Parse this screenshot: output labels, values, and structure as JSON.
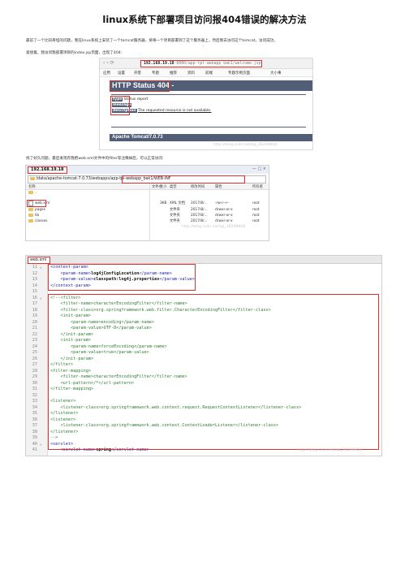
{
  "title": "linux系统下部署项目访问报404错误的解决方法",
  "intro_line1": "最前了一个比较奇怪的问题，我在linux系统上安装了一个tomcat服务器，将将一个项目部署到了这个服务器上，然后我去访问这个tomcat，访问成功，",
  "intro_dot": "·",
  "intro_line2": "紧接着，我访问我部署项目的index.jsp页面，出现了404:",
  "shot1": {
    "nav": "‹ › ⟳",
    "url_host": "192.168.19.18",
    "url_rest": ":8080/app-tpl-webapp_bak1/welcome.jsp",
    "bookmarks": [
      "应用",
      "设置",
      "开客",
      "专题",
      "推荐",
      "资料",
      "前端",
      "专题示例页面",
      "大小事"
    ],
    "error_title": "HTTP Status 404 -",
    "type_label": "type",
    "type_value": "Status report",
    "message_label": "message",
    "message_value": "",
    "description_label": "description",
    "description_value": "The requested resource is not available.",
    "footer": "Apache Tomcat/7.0.73",
    "watermark": "http://blog.csdn.net/qq_36298908"
  },
  "mid_text": "找了好久问题，最后发现有我把web.xml文件中的filter等注释掉后，可以正常访问:",
  "shot2": {
    "host": "192.168.19.18",
    "win_controls": "— □ ×",
    "path": "/data/apache-tomcat-7.0.73/webapps/app-tpl-webapp_bak1/WEB-INF",
    "left_header": "名称",
    "left_items": [
      {
        "name": "..",
        "type": "up"
      },
      {
        "name": "web.xml",
        "type": "file"
      },
      {
        "name": "pages",
        "type": "folder"
      },
      {
        "name": "lib",
        "type": "folder"
      },
      {
        "name": "classes",
        "type": "folder"
      }
    ],
    "right_headers": [
      "文件名",
      "大小",
      "类型",
      "修改时间",
      "属性",
      "所有者"
    ],
    "right_rows": [
      [
        "..",
        "",
        "",
        "",
        "",
        ""
      ],
      [
        "web.xml",
        "3KB",
        "XML 文档",
        "2017/8/...",
        "-rw-r--r--",
        "root"
      ],
      [
        "pages",
        "",
        "文件夹",
        "2017/8/...",
        "drwxr-xr-x",
        "root"
      ],
      [
        "lib",
        "",
        "文件夹",
        "2017/8/...",
        "drwxr-xr-x",
        "root"
      ],
      [
        "classes",
        "",
        "文件夹",
        "2017/8/...",
        "drwxr-xr-x",
        "root"
      ]
    ],
    "watermark": "http://blog.csdn.net/qq_36298908"
  },
  "shot3": {
    "tab": "web.xml ×",
    "lines": [
      {
        "n": "11",
        "f": "⊖",
        "h": "<span class=\"tag\">&lt;context-param&gt;</span>"
      },
      {
        "n": "12",
        "f": "",
        "h": "    <span class=\"tag\">&lt;param-name&gt;</span><span class=\"val\">log4jConfigLocation</span><span class=\"tag\">&lt;/param-name&gt;</span>"
      },
      {
        "n": "13",
        "f": "",
        "h": "    <span class=\"tag\">&lt;param-value&gt;</span><span class=\"val\">classpath:log4j.properties</span><span class=\"tag\">&lt;/param-value&gt;</span>"
      },
      {
        "n": "14",
        "f": "",
        "h": "<span class=\"tag\">&lt;/context-param&gt;</span>"
      },
      {
        "n": "15",
        "f": "",
        "h": ""
      },
      {
        "n": "16",
        "f": "⊖",
        "h": "<span class=\"cmt\">&lt;!--&lt;filter&gt;</span>"
      },
      {
        "n": "17",
        "f": "",
        "h": "<span class=\"cmt\">    &lt;filter-name&gt;characterEncodingFilter&lt;/filter-name&gt;</span>"
      },
      {
        "n": "18",
        "f": "",
        "h": "<span class=\"cmt\">    &lt;filter-class&gt;org.springframework.web.filter.CharacterEncodingFilter&lt;/filter-class&gt;</span>"
      },
      {
        "n": "19",
        "f": "",
        "h": "<span class=\"cmt\">    &lt;init-param&gt;</span>"
      },
      {
        "n": "20",
        "f": "",
        "h": "<span class=\"cmt\">        &lt;param-name&gt;encoding&lt;/param-name&gt;</span>"
      },
      {
        "n": "21",
        "f": "",
        "h": "<span class=\"cmt\">        &lt;param-value&gt;UTF-8&lt;/param-value&gt;</span>"
      },
      {
        "n": "22",
        "f": "",
        "h": "<span class=\"cmt\">    &lt;/init-param&gt;</span>"
      },
      {
        "n": "23",
        "f": "",
        "h": "<span class=\"cmt\">    &lt;init-param&gt;</span>"
      },
      {
        "n": "24",
        "f": "",
        "h": "<span class=\"cmt\">        &lt;param-name&gt;forceEncoding&lt;/param-name&gt;</span>"
      },
      {
        "n": "25",
        "f": "",
        "h": "<span class=\"cmt\">        &lt;param-value&gt;true&lt;/param-value&gt;</span>"
      },
      {
        "n": "26",
        "f": "",
        "h": "<span class=\"cmt\">    &lt;/init-param&gt;</span>"
      },
      {
        "n": "27",
        "f": "",
        "h": "<span class=\"cmt\">&lt;/filter&gt;</span>"
      },
      {
        "n": "28",
        "f": "",
        "h": "<span class=\"cmt\">&lt;filter-mapping&gt;</span>"
      },
      {
        "n": "29",
        "f": "",
        "h": "<span class=\"cmt\">    &lt;filter-name&gt;characterEncodingFilter&lt;/filter-name&gt;</span>"
      },
      {
        "n": "30",
        "f": "",
        "h": "<span class=\"cmt\">    &lt;url-pattern&gt;/*&lt;/url-pattern&gt;</span>"
      },
      {
        "n": "31",
        "f": "",
        "h": "<span class=\"cmt\">&lt;/filter-mapping&gt;</span>"
      },
      {
        "n": "32",
        "f": "",
        "h": ""
      },
      {
        "n": "33",
        "f": "",
        "h": "<span class=\"cmt\">&lt;listener&gt;</span>"
      },
      {
        "n": "34",
        "f": "",
        "h": "<span class=\"cmt\">    &lt;listener-class&gt;org.springframework.web.context.request.RequestContextListener&lt;/listener-class&gt;</span>"
      },
      {
        "n": "35",
        "f": "",
        "h": "<span class=\"cmt\">&lt;/listener&gt;</span>"
      },
      {
        "n": "36",
        "f": "",
        "h": "<span class=\"cmt\">&lt;listener&gt;</span>"
      },
      {
        "n": "37",
        "f": "",
        "h": "<span class=\"cmt\">    &lt;listener-class&gt;org.springframework.web.context.ContextLoaderListener&lt;/listener-class&gt;</span>"
      },
      {
        "n": "38",
        "f": "",
        "h": "<span class=\"cmt\">&lt;/listener&gt;</span>"
      },
      {
        "n": "39",
        "f": "",
        "h": "<span class=\"cmt\">--&gt;</span>"
      },
      {
        "n": "40",
        "f": "⊖",
        "h": "<span class=\"tag\">&lt;servlet&gt;</span>"
      },
      {
        "n": "41",
        "f": "",
        "h": "    <span class=\"tag\">&lt;servlet-name&gt;</span><span class=\"val\">spring</span><span class=\"tag\">&lt;/servlet-name&gt;</span>"
      }
    ],
    "watermark": "http://blog.csdn.net/qq_36298908"
  }
}
